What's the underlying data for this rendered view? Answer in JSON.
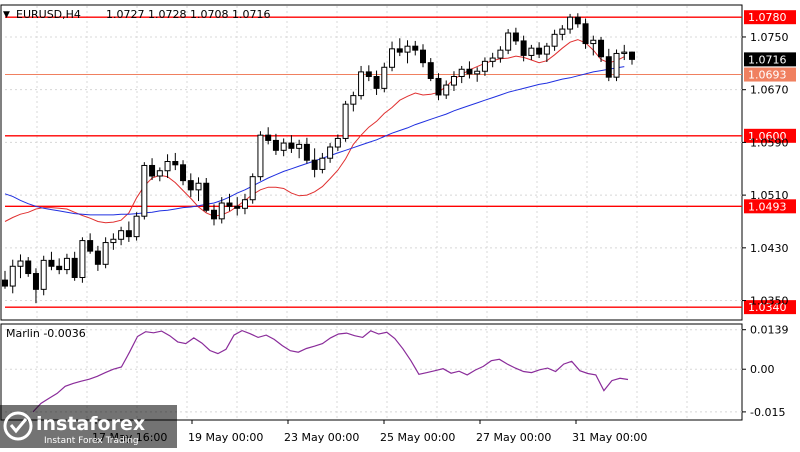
{
  "header": {
    "symbol": "EURUSD,H4",
    "ohlc": "1.0727 1.0728 1.0708 1.0716",
    "indicator_label": "Marlin -0.0036"
  },
  "watermark": {
    "brand": "instaforex",
    "tagline": "Instant Forex Trading"
  },
  "chart_data": [
    {
      "type": "candlestick",
      "ylim": [
        1.0322,
        1.0797
      ],
      "yticks": [
        "1.0750",
        "1.0670",
        "1.0590",
        "1.0510",
        "1.0430",
        "1.0350"
      ],
      "price_tag": {
        "value": "1.0716",
        "color": "#000000"
      },
      "grid": true,
      "horizontal_levels": [
        {
          "value": 1.078,
          "label": "1.0780",
          "color": "#ff0000",
          "width": "thick"
        },
        {
          "value": 1.0693,
          "label": "1.0693",
          "color": "#f08060",
          "width": "thin"
        },
        {
          "value": 1.06,
          "label": "1.0600",
          "color": "#ff0000",
          "width": "thick"
        },
        {
          "value": 1.0493,
          "label": "1.0493",
          "color": "#ff0000",
          "width": "thick"
        },
        {
          "value": 1.034,
          "label": "1.0340",
          "color": "#ff0000",
          "width": "thick"
        }
      ],
      "candles": [
        [
          1.0381,
          1.0395,
          1.0368,
          1.0372
        ],
        [
          1.0372,
          1.0412,
          1.0361,
          1.0402
        ],
        [
          1.0402,
          1.042,
          1.0384,
          1.041
        ],
        [
          1.041,
          1.0416,
          1.0386,
          1.0391
        ],
        [
          1.0391,
          1.0399,
          1.0346,
          1.0367
        ],
        [
          1.0367,
          1.0418,
          1.0358,
          1.0411
        ],
        [
          1.0411,
          1.0424,
          1.0396,
          1.0402
        ],
        [
          1.0402,
          1.0414,
          1.039,
          1.0397
        ],
        [
          1.0397,
          1.0421,
          1.039,
          1.0414
        ],
        [
          1.0414,
          1.0424,
          1.038,
          1.0385
        ],
        [
          1.0385,
          1.0446,
          1.0377,
          1.0441
        ],
        [
          1.0441,
          1.0452,
          1.0421,
          1.0425
        ],
        [
          1.0425,
          1.0433,
          1.0395,
          1.0405
        ],
        [
          1.0405,
          1.0446,
          1.0399,
          1.0438
        ],
        [
          1.0438,
          1.0452,
          1.0427,
          1.0443
        ],
        [
          1.0443,
          1.0462,
          1.0434,
          1.0456
        ],
        [
          1.0456,
          1.047,
          1.0439,
          1.0447
        ],
        [
          1.0447,
          1.0484,
          1.0441,
          1.0478
        ],
        [
          1.0478,
          1.056,
          1.0473,
          1.0555
        ],
        [
          1.0555,
          1.0566,
          1.0533,
          1.0539
        ],
        [
          1.0539,
          1.0552,
          1.0531,
          1.0547
        ],
        [
          1.0547,
          1.0572,
          1.0536,
          1.0561
        ],
        [
          1.0561,
          1.0574,
          1.0548,
          1.0556
        ],
        [
          1.0556,
          1.0563,
          1.0525,
          1.0532
        ],
        [
          1.0532,
          1.0543,
          1.0507,
          1.0518
        ],
        [
          1.0518,
          1.0537,
          1.0501,
          1.0528
        ],
        [
          1.0528,
          1.0536,
          1.0484,
          1.0487
        ],
        [
          1.0487,
          1.0496,
          1.0464,
          1.0474
        ],
        [
          1.0474,
          1.0507,
          1.0467,
          1.0498
        ],
        [
          1.0498,
          1.0512,
          1.0486,
          1.0493
        ],
        [
          1.0493,
          1.0507,
          1.0479,
          1.049
        ],
        [
          1.049,
          1.0512,
          1.0481,
          1.0503
        ],
        [
          1.0503,
          1.0543,
          1.0497,
          1.0538
        ],
        [
          1.0538,
          1.0607,
          1.0532,
          1.0601
        ],
        [
          1.0601,
          1.0613,
          1.0587,
          1.0593
        ],
        [
          1.0593,
          1.0603,
          1.0571,
          1.0578
        ],
        [
          1.0578,
          1.0596,
          1.0569,
          1.0589
        ],
        [
          1.0589,
          1.0601,
          1.0574,
          1.0581
        ],
        [
          1.0581,
          1.0594,
          1.0566,
          1.0587
        ],
        [
          1.0587,
          1.0597,
          1.0558,
          1.0563
        ],
        [
          1.0563,
          1.0581,
          1.0537,
          1.0549
        ],
        [
          1.0549,
          1.0574,
          1.0543,
          1.0566
        ],
        [
          1.0566,
          1.0589,
          1.0559,
          1.0583
        ],
        [
          1.0583,
          1.0602,
          1.0577,
          1.0596
        ],
        [
          1.0596,
          1.0653,
          1.0591,
          1.0648
        ],
        [
          1.0648,
          1.0667,
          1.0637,
          1.0661
        ],
        [
          1.0661,
          1.0706,
          1.0655,
          1.0697
        ],
        [
          1.0697,
          1.0707,
          1.0683,
          1.069
        ],
        [
          1.069,
          1.0699,
          1.0662,
          1.0672
        ],
        [
          1.0672,
          1.0711,
          1.0666,
          1.0704
        ],
        [
          1.0704,
          1.0743,
          1.0698,
          1.0732
        ],
        [
          1.0732,
          1.0748,
          1.0721,
          1.0727
        ],
        [
          1.0727,
          1.0745,
          1.071,
          1.0736
        ],
        [
          1.0736,
          1.0744,
          1.0722,
          1.073
        ],
        [
          1.073,
          1.0739,
          1.0704,
          1.0711
        ],
        [
          1.0711,
          1.0718,
          1.0683,
          1.0687
        ],
        [
          1.0687,
          1.0695,
          1.0654,
          1.0662
        ],
        [
          1.0662,
          1.0684,
          1.0656,
          1.0677
        ],
        [
          1.0677,
          1.0698,
          1.0668,
          1.069
        ],
        [
          1.069,
          1.0706,
          1.068,
          1.0701
        ],
        [
          1.0701,
          1.0713,
          1.0687,
          1.0694
        ],
        [
          1.0694,
          1.0704,
          1.0682,
          1.0698
        ],
        [
          1.0698,
          1.0719,
          1.0691,
          1.0713
        ],
        [
          1.0713,
          1.0726,
          1.0704,
          1.0718
        ],
        [
          1.0718,
          1.0736,
          1.0711,
          1.073
        ],
        [
          1.073,
          1.0762,
          1.0724,
          1.0756
        ],
        [
          1.0756,
          1.0764,
          1.0738,
          1.0744
        ],
        [
          1.0744,
          1.0752,
          1.0713,
          1.0722
        ],
        [
          1.0722,
          1.0738,
          1.0715,
          1.0733
        ],
        [
          1.0733,
          1.0742,
          1.0718,
          1.0724
        ],
        [
          1.0724,
          1.0741,
          1.0712,
          1.0736
        ],
        [
          1.0736,
          1.0761,
          1.0729,
          1.0754
        ],
        [
          1.0754,
          1.0768,
          1.0745,
          1.0762
        ],
        [
          1.0762,
          1.0785,
          1.0755,
          1.078
        ],
        [
          1.078,
          1.0786,
          1.0764,
          1.077
        ],
        [
          1.077,
          1.0778,
          1.0732,
          1.074
        ],
        [
          1.074,
          1.0752,
          1.0722,
          1.0745
        ],
        [
          1.0745,
          1.075,
          1.0712,
          1.072
        ],
        [
          1.072,
          1.0732,
          1.0683,
          1.0689
        ],
        [
          1.0689,
          1.0731,
          1.0683,
          1.0725
        ],
        [
          1.0725,
          1.0738,
          1.0715,
          1.0727
        ],
        [
          1.0727,
          1.0728,
          1.0708,
          1.0716
        ]
      ],
      "series": [
        {
          "type": "line",
          "color": "#e03030",
          "values": [
            1.047,
            1.0476,
            1.0481,
            1.0484,
            1.0489,
            1.0491,
            1.0491,
            1.049,
            1.0489,
            1.0484,
            1.0479,
            1.0475,
            1.047,
            1.0468,
            1.0469,
            1.0472,
            1.0483,
            1.0506,
            1.0524,
            1.0536,
            1.054,
            1.0538,
            1.0529,
            1.0517,
            1.0505,
            1.0492,
            1.0483,
            1.0478,
            1.048,
            1.0485,
            1.0493,
            1.0502,
            1.0511,
            1.0518,
            1.0522,
            1.0522,
            1.052,
            1.0513,
            1.0509,
            1.051,
            1.0515,
            1.0523,
            1.0535,
            1.0548,
            1.0565,
            1.0587,
            1.0601,
            1.0613,
            1.0622,
            1.0634,
            1.0643,
            1.0654,
            1.066,
            1.0665,
            1.0662,
            1.0663,
            1.0666,
            1.0675,
            1.0686,
            1.0693,
            1.07,
            1.0705,
            1.071,
            1.0714,
            1.0717,
            1.0718,
            1.0721,
            1.0719,
            1.0715,
            1.0711,
            1.0714,
            1.0723,
            1.0733,
            1.0742,
            1.0746,
            1.0741,
            1.073,
            1.0716,
            1.0711,
            1.0714,
            1.072
          ]
        },
        {
          "type": "line",
          "color": "#2030e0",
          "values": [
            1.0512,
            1.0508,
            1.0502,
            1.0497,
            1.0493,
            1.049,
            1.0488,
            1.0486,
            1.0484,
            1.0482,
            1.0481,
            1.048,
            1.048,
            1.048,
            1.048,
            1.0481,
            1.0481,
            1.0482,
            1.0483,
            1.0484,
            1.0486,
            1.0487,
            1.0489,
            1.0491,
            1.0492,
            1.0494,
            1.0496,
            1.0498,
            1.0502,
            1.0507,
            1.0513,
            1.0518,
            1.0524,
            1.053,
            1.0536,
            1.0541,
            1.0546,
            1.055,
            1.0554,
            1.0558,
            1.0562,
            1.0566,
            1.057,
            1.0574,
            1.0578,
            1.0582,
            1.0586,
            1.059,
            1.0594,
            1.0599,
            1.0604,
            1.0608,
            1.0612,
            1.0617,
            1.0621,
            1.0625,
            1.0629,
            1.0633,
            1.0638,
            1.0642,
            1.0646,
            1.065,
            1.0654,
            1.0658,
            1.0662,
            1.0666,
            1.0669,
            1.0672,
            1.0675,
            1.0678,
            1.068,
            1.0683,
            1.0686,
            1.0688,
            1.0691,
            1.0694,
            1.0697,
            1.0699,
            1.0701,
            1.0703,
            1.0705
          ]
        }
      ]
    },
    {
      "type": "line",
      "title": "Marlin -0.0036",
      "ylim": [
        -0.0175,
        0.0152
      ],
      "yticks": [
        "0.0139",
        "0.00",
        "-0.015"
      ],
      "series": [
        {
          "color": "#8a2c9a",
          "values": [
            -0.015,
            -0.012,
            -0.0102,
            -0.0085,
            -0.006,
            -0.005,
            -0.0042,
            -0.0035,
            -0.0025,
            -0.0012,
            0.0,
            0.0008,
            0.006,
            0.0115,
            0.0132,
            0.0128,
            0.0134,
            0.0118,
            0.0096,
            0.009,
            0.011,
            0.0092,
            0.0066,
            0.0055,
            0.007,
            0.012,
            0.0136,
            0.0125,
            0.0112,
            0.012,
            0.0105,
            0.0083,
            0.0065,
            0.006,
            0.0073,
            0.0081,
            0.009,
            0.011,
            0.0124,
            0.0127,
            0.0118,
            0.0112,
            0.0135,
            0.0124,
            0.013,
            0.0108,
            0.0072,
            0.003,
            -0.0018,
            -0.0012,
            -0.0005,
            0.0002,
            -0.0014,
            -0.0007,
            -0.002,
            -0.0003,
            0.001,
            0.003,
            0.0035,
            0.0018,
            0.0004,
            -0.0008,
            -0.0012,
            -0.0002,
            0.0004,
            -0.0008,
            0.0018,
            0.0028,
            -0.0005,
            -0.0015,
            -0.002,
            -0.0075,
            -0.004,
            -0.0032,
            -0.0036
          ]
        }
      ]
    }
  ],
  "time_axis": {
    "labels": [
      "17 May 16:00",
      "19 May 00:00",
      "23 May 00:00",
      "25 May 00:00",
      "27 May 00:00",
      "31 May 00:00"
    ]
  }
}
